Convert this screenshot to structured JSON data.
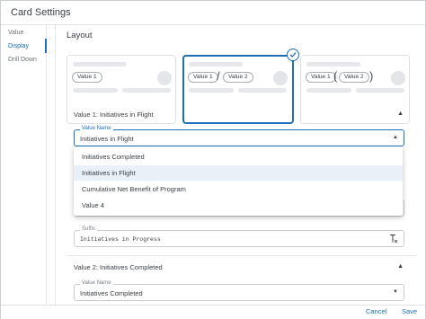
{
  "window": {
    "title": "Card Settings"
  },
  "sidebar": {
    "items": [
      {
        "label": "Value"
      },
      {
        "label": "Display"
      },
      {
        "label": "Drill Down"
      }
    ]
  },
  "main": {
    "section_title": "Layout",
    "layout_options": [
      {
        "pills": [
          "Value 1"
        ]
      },
      {
        "pills": [
          "Value 1",
          "Value 2"
        ],
        "separator": "/"
      },
      {
        "pills": [
          "Value 1",
          "Value 2"
        ],
        "separator_open": "(",
        "separator_close": ")"
      }
    ],
    "group1": {
      "title": "Value 1: Initiatives in Flight",
      "value_name_label": "Value Name",
      "value_name": "Initiatives in Flight",
      "suffix_label": "Suffix",
      "suffix_value": "Initiatives in Progress"
    },
    "group2": {
      "title": "Value 2: Initiatives Completed",
      "value_name_label": "Value Name",
      "value_name": "Initiatives Completed"
    }
  },
  "dropdown": {
    "options": [
      {
        "label": "Initiatives Completed"
      },
      {
        "label": "Initiatives in Flight"
      },
      {
        "label": "Cumulative Net Benefit of Program"
      },
      {
        "label": "Value 4"
      }
    ]
  },
  "footer": {
    "cancel": "Cancel",
    "save": "Save"
  },
  "colors": {
    "accent": "#1d6fb8",
    "highlight": "#e8f0f8"
  }
}
